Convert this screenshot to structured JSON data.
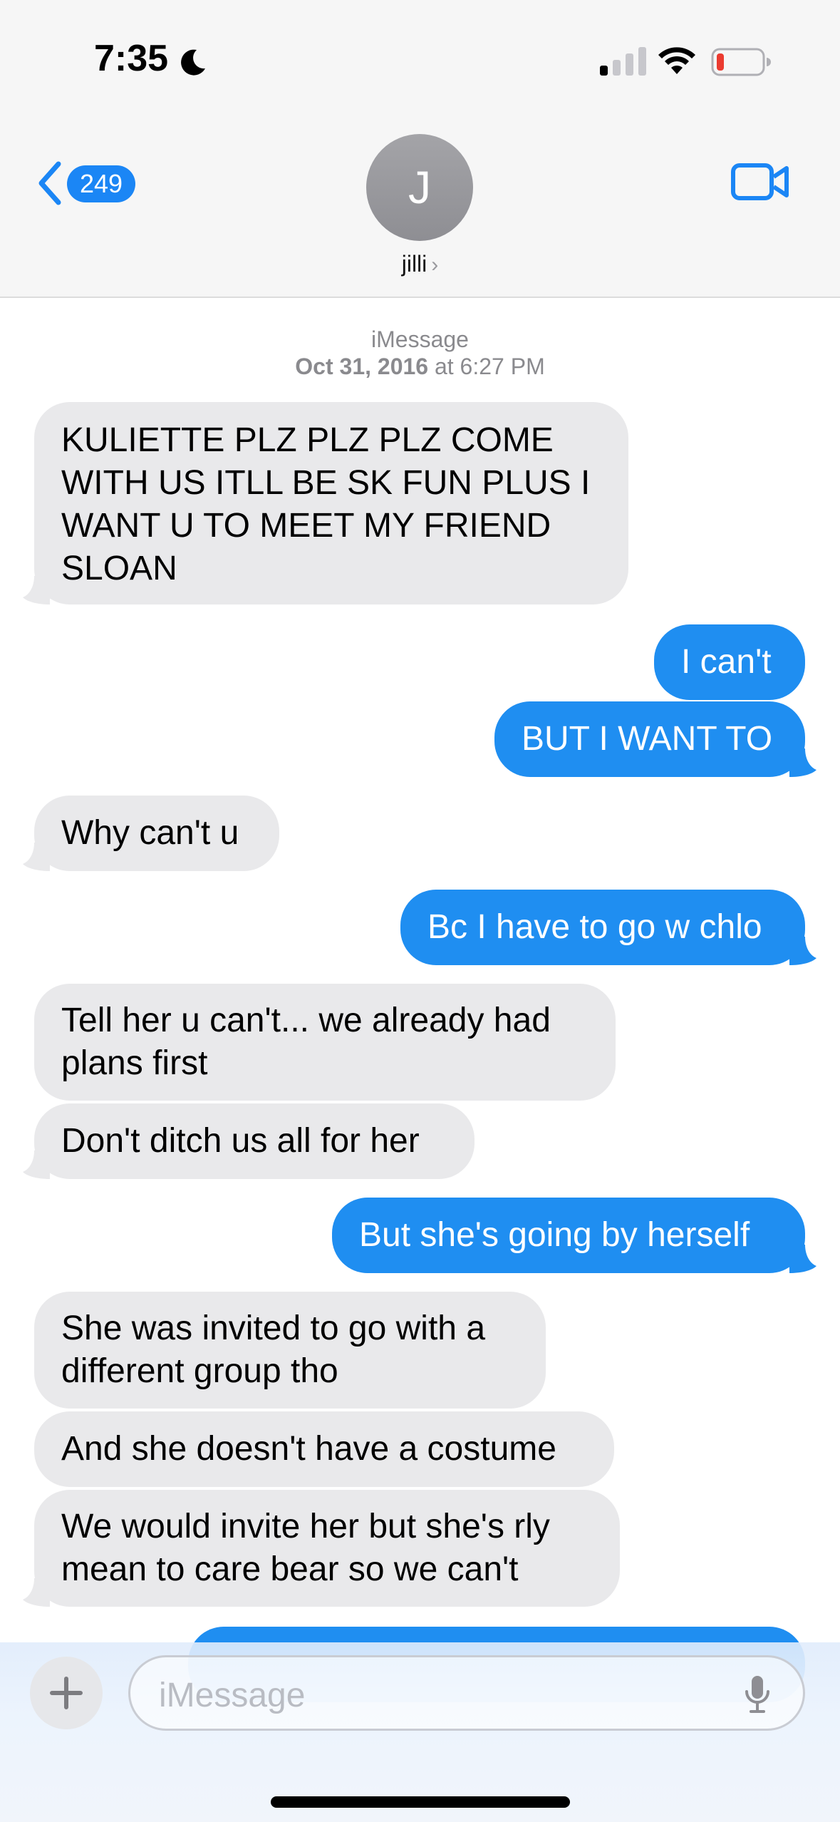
{
  "status_bar": {
    "time": "7:35",
    "moon_icon": "moon-icon",
    "signal_icon": "cellular-signal-icon",
    "wifi_icon": "wifi-icon",
    "battery_icon": "battery-low-icon",
    "battery_level": 0.12
  },
  "header": {
    "back_count": "249",
    "avatar_initial": "J",
    "contact_name": "jilli",
    "contact_chevron": "›",
    "video_icon": "video-camera-icon",
    "back_icon": "chevron-left-icon"
  },
  "conversation": {
    "service": "iMessage",
    "date": "Oct 31, 2016",
    "date_word": "at",
    "time": "6:27 PM",
    "messages": [
      {
        "dir": "in",
        "lines": [
          "KULIETTE PLZ PLZ PLZ COME",
          "WITH US ITLL BE SK FUN PLUS I",
          "WANT U TO MEET MY FRIEND",
          "SLOAN"
        ]
      },
      {
        "dir": "out",
        "lines": [
          "I can't"
        ]
      },
      {
        "dir": "out",
        "lines": [
          "BUT I WANT TO"
        ]
      },
      {
        "dir": "in",
        "lines": [
          "Why can't u"
        ]
      },
      {
        "dir": "out",
        "lines": [
          "Bc I have to go w chlo"
        ]
      },
      {
        "dir": "in",
        "lines": [
          "Tell her u can't... we already had",
          "plans first"
        ]
      },
      {
        "dir": "in",
        "lines": [
          "Don't ditch us all for her"
        ]
      },
      {
        "dir": "out",
        "lines": [
          "But she's going by herself"
        ]
      },
      {
        "dir": "in",
        "lines": [
          "She was invited to go with a",
          "different group tho"
        ]
      },
      {
        "dir": "in",
        "lines": [
          "And she doesn't have a costume"
        ]
      },
      {
        "dir": "in",
        "lines": [
          "We would invite her but she's rly",
          "mean to care bear so we can't"
        ]
      },
      {
        "dir": "out",
        "lines": [
          ""
        ]
      }
    ]
  },
  "composer": {
    "plus_icon": "plus-icon",
    "placeholder": "iMessage",
    "mic_icon": "microphone-icon"
  },
  "colors": {
    "outgoing": "#1f8ef1",
    "incoming": "#e9e9eb",
    "accent": "#1b86f5"
  }
}
